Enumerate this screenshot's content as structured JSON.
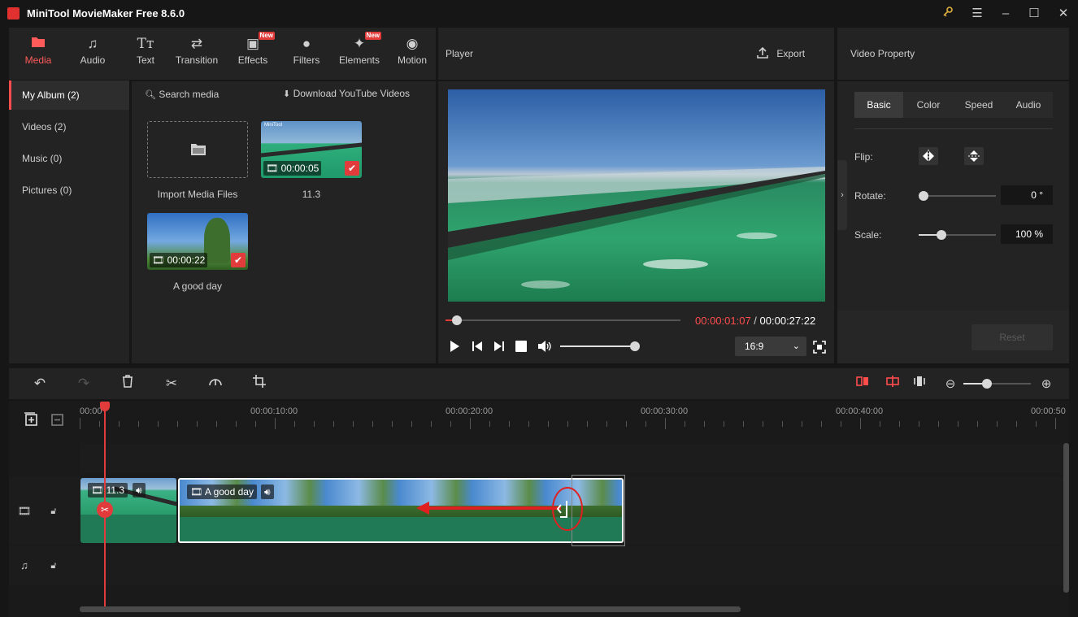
{
  "app": {
    "title": "MiniTool MovieMaker Free 8.6.0"
  },
  "window_controls": {
    "key_icon": "key-icon",
    "menu_icon": "menu-icon"
  },
  "toolbar": {
    "items": [
      {
        "label": "Media",
        "icon": "folder-icon",
        "active": true,
        "new": false
      },
      {
        "label": "Audio",
        "icon": "music-note-icon",
        "active": false,
        "new": false
      },
      {
        "label": "Text",
        "icon": "text-icon",
        "active": false,
        "new": false
      },
      {
        "label": "Transition",
        "icon": "transition-icon",
        "active": false,
        "new": false
      },
      {
        "label": "Effects",
        "icon": "effects-icon",
        "active": false,
        "new": true
      },
      {
        "label": "Filters",
        "icon": "filters-icon",
        "active": false,
        "new": false
      },
      {
        "label": "Elements",
        "icon": "elements-icon",
        "active": false,
        "new": true
      },
      {
        "label": "Motion",
        "icon": "motion-icon",
        "active": false,
        "new": false
      }
    ],
    "new_badge": "New"
  },
  "sidebar": {
    "items": [
      {
        "label": "My Album (2)",
        "active": true
      },
      {
        "label": "Videos (2)",
        "active": false
      },
      {
        "label": "Music (0)",
        "active": false
      },
      {
        "label": "Pictures (0)",
        "active": false
      }
    ]
  },
  "media": {
    "search_placeholder": "Search media",
    "download_label": "Download YouTube Videos",
    "import_label": "Import Media Files",
    "items": [
      {
        "name": "11.3",
        "duration": "00:00:05",
        "watermark": "MiniTool"
      },
      {
        "name": "A good day",
        "duration": "00:00:22"
      }
    ]
  },
  "player": {
    "title": "Player",
    "export_label": "Export",
    "current_time": "00:00:01:07",
    "separator": " / ",
    "total_time": "00:00:27:22",
    "progress": 0.05,
    "volume": 0.98,
    "aspect_ratio": "16:9"
  },
  "property": {
    "title": "Video Property",
    "tabs": [
      {
        "label": "Basic",
        "active": true
      },
      {
        "label": "Color",
        "active": false
      },
      {
        "label": "Speed",
        "active": false
      },
      {
        "label": "Audio",
        "active": false
      }
    ],
    "flip_label": "Flip:",
    "rotate_label": "Rotate:",
    "rotate_value": "0 °",
    "rotate_level": 0.0,
    "scale_label": "Scale:",
    "scale_value": "100 %",
    "scale_level": 0.29,
    "reset_label": "Reset"
  },
  "timeline": {
    "ruler": [
      "00:00",
      "00:00:10:00",
      "00:00:20:00",
      "00:00:30:00",
      "00:00:40:00",
      "00:00:50"
    ],
    "clips": [
      {
        "name": "11.3"
      },
      {
        "name": "A good day"
      }
    ],
    "zoom_level": 0.35
  },
  "colors": {
    "accent": "#e23b3b",
    "clip_green": "#1f7a55",
    "current_time": "#ff4d4d"
  }
}
